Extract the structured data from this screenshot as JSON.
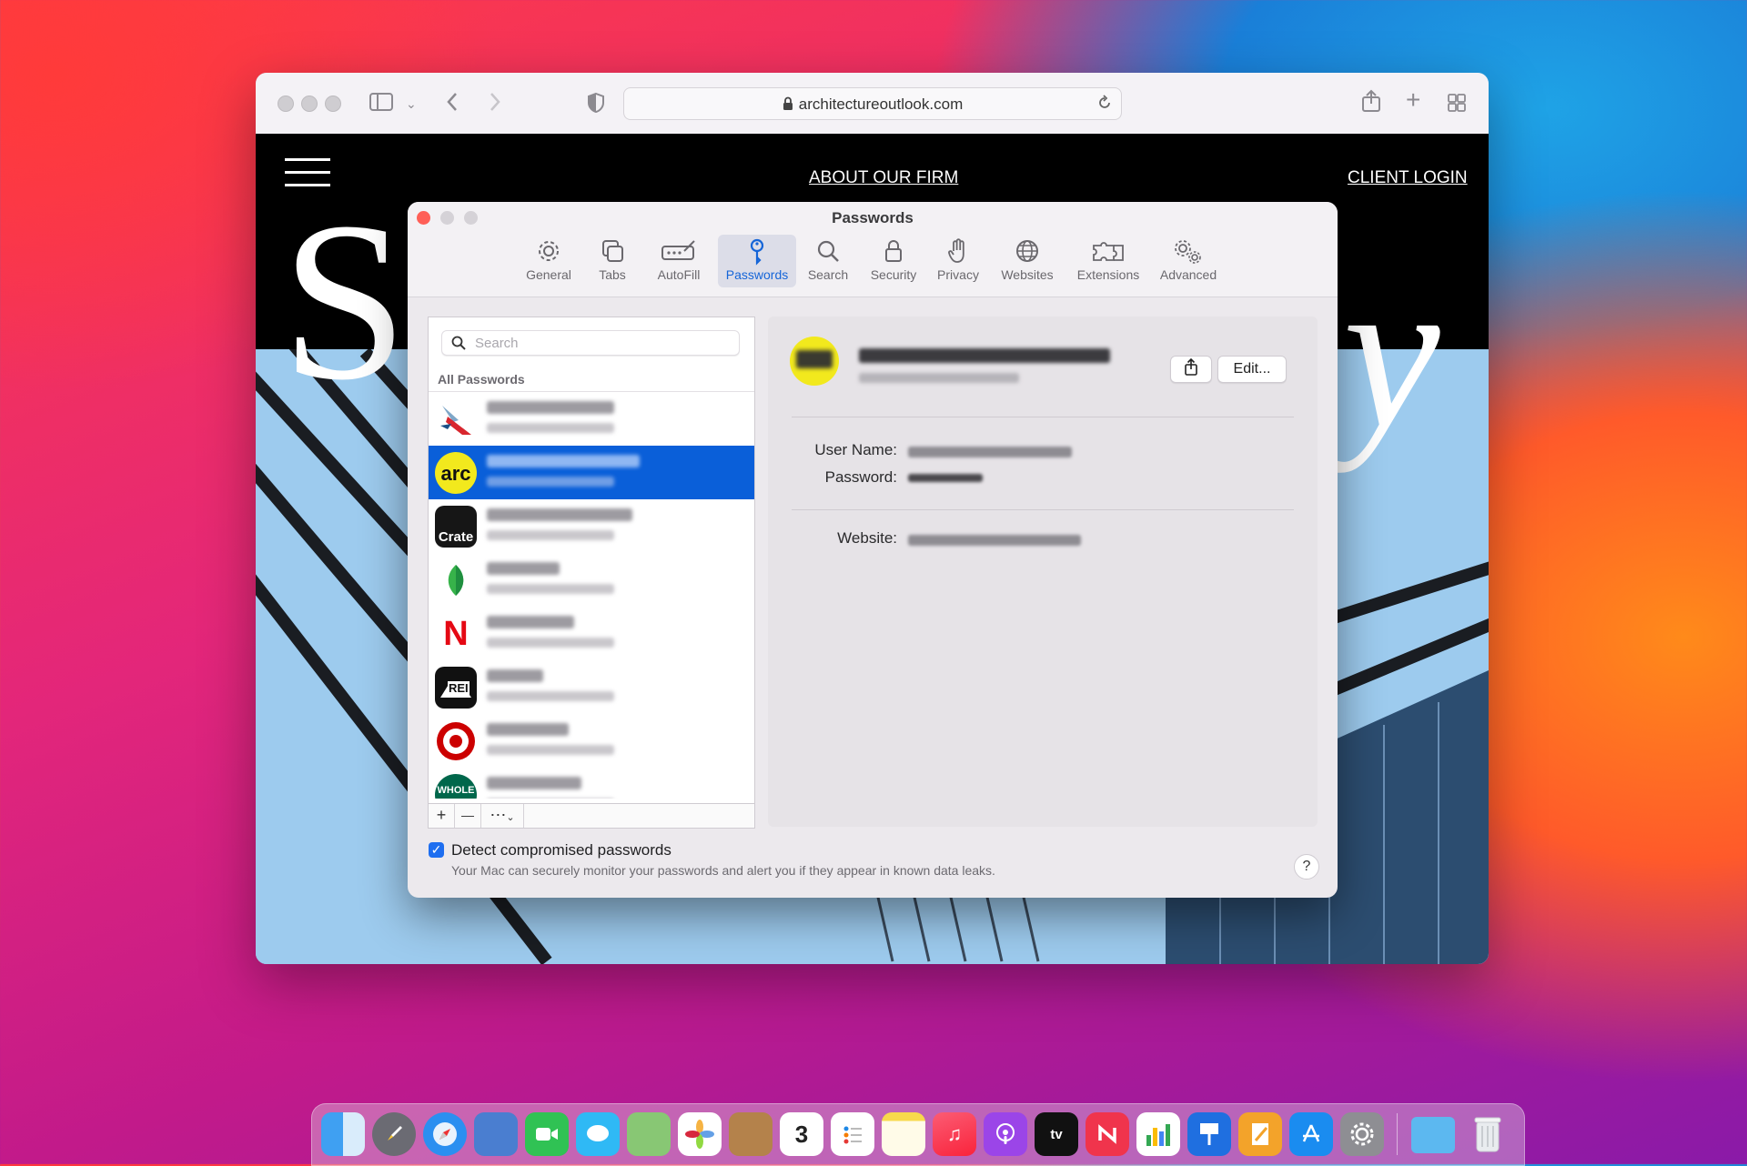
{
  "browser": {
    "url": "architectureoutlook.com",
    "nav_links": [
      "ABOUT OUR FIRM",
      "CLIENT LOGIN"
    ],
    "hero_letters": [
      "S",
      "y"
    ]
  },
  "panel": {
    "title": "Passwords",
    "tabs": [
      {
        "label": "General",
        "icon": "gear-icon"
      },
      {
        "label": "Tabs",
        "icon": "tabs-icon"
      },
      {
        "label": "AutoFill",
        "icon": "autofill-icon"
      },
      {
        "label": "Passwords",
        "icon": "key-icon",
        "active": true
      },
      {
        "label": "Search",
        "icon": "magnifier-icon"
      },
      {
        "label": "Security",
        "icon": "lock-icon"
      },
      {
        "label": "Privacy",
        "icon": "hand-icon"
      },
      {
        "label": "Websites",
        "icon": "globe-icon"
      },
      {
        "label": "Extensions",
        "icon": "puzzle-icon"
      },
      {
        "label": "Advanced",
        "icon": "gears-icon"
      }
    ],
    "search_placeholder": "Search",
    "list_header": "All Passwords",
    "list_logos": [
      {
        "name": "american-airlines-logo",
        "text": ""
      },
      {
        "name": "arc-logo",
        "text": "arc"
      },
      {
        "name": "crate-logo",
        "text": "Crate"
      },
      {
        "name": "mint-logo",
        "text": ""
      },
      {
        "name": "netflix-logo",
        "text": "N"
      },
      {
        "name": "rei-logo",
        "text": "REI"
      },
      {
        "name": "target-logo",
        "text": ""
      },
      {
        "name": "wholefoods-logo",
        "text": "WHOLE"
      }
    ],
    "list_buttons": [
      "+",
      "—",
      "⋯"
    ],
    "detail": {
      "edit_label": "Edit...",
      "username_label": "User Name:",
      "password_label": "Password:",
      "website_label": "Website:"
    },
    "detect_label": "Detect compromised passwords",
    "detect_sub": "Your Mac can securely monitor your passwords and alert you if they appear in known data leaks.",
    "help": "?"
  },
  "dock": {
    "apps": [
      "finder",
      "launchpad",
      "safari",
      "preview",
      "facetime",
      "messages",
      "maps",
      "photos",
      "contacts",
      "calendar",
      "reminders",
      "notes",
      "music",
      "podcasts",
      "tv",
      "news",
      "numbers",
      "keynote",
      "pages",
      "app-store",
      "system-preferences",
      "downloads",
      "trash"
    ],
    "calendar_day": "3",
    "tv_label": "tv"
  }
}
